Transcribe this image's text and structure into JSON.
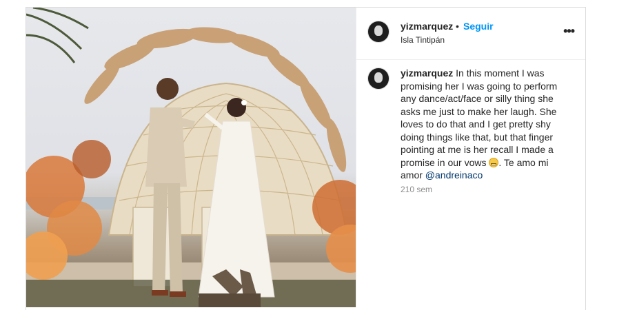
{
  "post": {
    "username": "yizmarquez",
    "separator": "•",
    "follow_label": "Seguir",
    "location": "Isla Tintipán",
    "more_icon": "more-options-icon",
    "more_label": "•••"
  },
  "caption": {
    "username": "yizmarquez",
    "text": "In this moment I was promising her I was going to perform any dance/act/face or silly thing she asks me just to make her laugh. She loves to do that and I get pretty shy doing things like that, but that finger pointing at me is her recall I made a promise in our vows ",
    "emoji_icon": "grimacing-face-emoji",
    "text_after": ". Te amo mi amor ",
    "mention": "@andreinaco",
    "time": "210 sem"
  },
  "colors": {
    "follow": "#0095f6",
    "mention": "#00376b",
    "muted": "#8e8e8e",
    "text": "#262626"
  }
}
